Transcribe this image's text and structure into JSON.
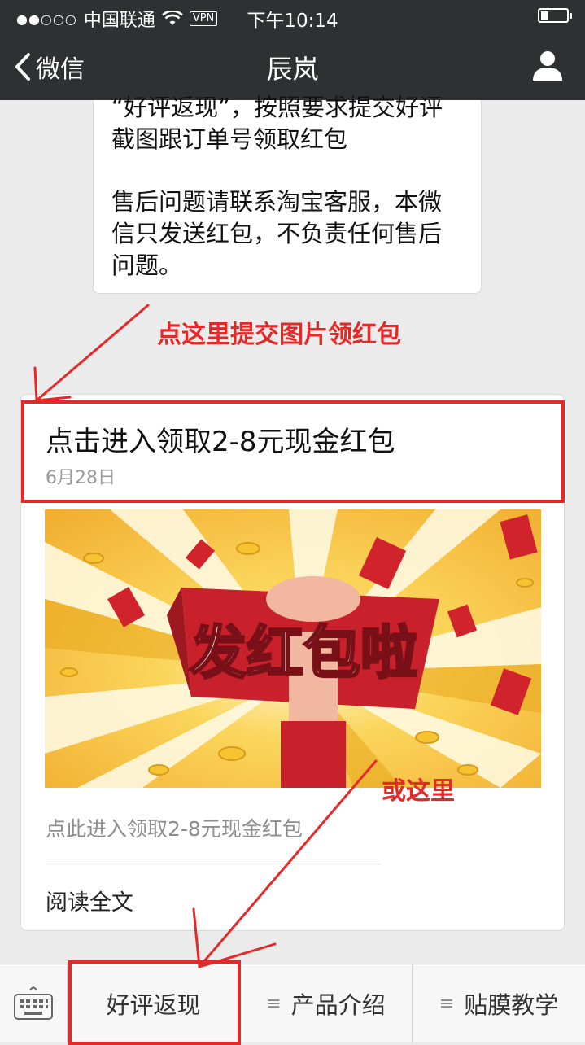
{
  "status_bar": {
    "signal": "●●○○○",
    "carrier": "中国联通",
    "vpn": "VPN",
    "time": "下午10:14",
    "battery_level": 0.3
  },
  "nav": {
    "back_label": "微信",
    "title": "辰岚"
  },
  "message": {
    "clipped_line": "“好评返现”，按照要求提交好评",
    "lines": [
      "截图跟订单号领取红包",
      "售后问题请联系淘宝客服，本微",
      "信只发送红包，不负责任何售后",
      "问题。"
    ]
  },
  "annotations": {
    "submit_hint": "点这里提交图片领红包",
    "or_here": "或这里"
  },
  "article": {
    "title": "点击进入领取2-8元现金红包",
    "date": "6月28日",
    "cover_text": "发红包啦",
    "summary": "点此进入领取2-8元现金红包",
    "read_more": "阅读全文"
  },
  "menu": {
    "items": [
      {
        "label": "好评返现",
        "has_submenu": false
      },
      {
        "label": "产品介绍",
        "has_submenu": true
      },
      {
        "label": "贴膜教学",
        "has_submenu": true
      }
    ]
  },
  "colors": {
    "annotation_red": "#e52828",
    "topbar": "#2e3132",
    "cover_red": "#c8212b",
    "cover_yellow": "#f5c23a"
  }
}
